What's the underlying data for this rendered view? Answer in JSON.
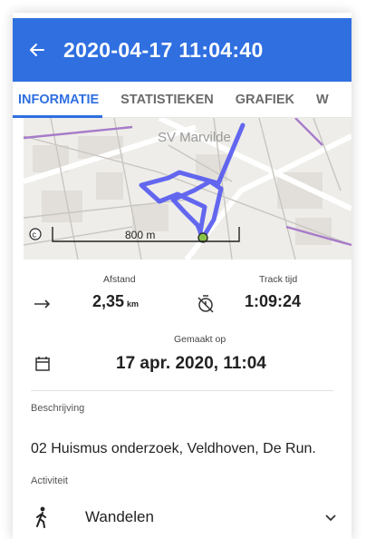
{
  "header": {
    "back_icon": "arrow-left-icon",
    "title": "2020-04-17 11:04:40",
    "color": "#2f6fe0"
  },
  "tabs": [
    {
      "label": "INFORMATIE",
      "active": true
    },
    {
      "label": "STATISTIEKEN",
      "active": false
    },
    {
      "label": "GRAFIEK",
      "active": false
    },
    {
      "label": "W",
      "active": false
    }
  ],
  "map": {
    "place_label": "SV Marvilde",
    "scale_label": "800 m",
    "copyright_icon": "copyright-icon",
    "track_color": "#4a4ff0"
  },
  "stats": {
    "distance": {
      "label": "Afstand",
      "value": "2,35",
      "unit": "km",
      "icon": "arrow-right-icon"
    },
    "track_time": {
      "label": "Track tijd",
      "value": "1:09:24",
      "icon": "timer-off-icon"
    },
    "created": {
      "label": "Gemaakt op",
      "value": "17 apr. 2020, 11:04",
      "icon": "calendar-icon"
    }
  },
  "description": {
    "label": "Beschrijving",
    "value": "02 Huismus onderzoek, Veldhoven, De Run."
  },
  "activity": {
    "label": "Activiteit",
    "value": "Wandelen",
    "icon": "walking-icon",
    "dropdown_icon": "chevron-down-icon"
  }
}
